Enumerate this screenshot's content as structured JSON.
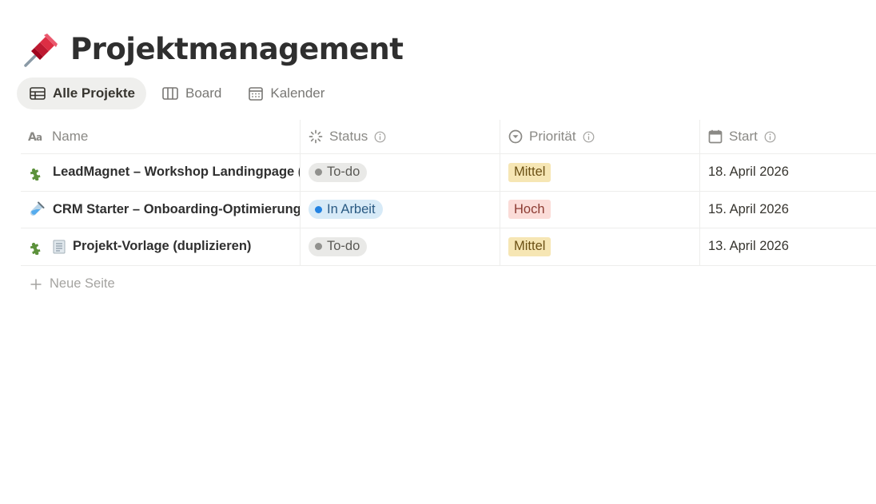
{
  "page": {
    "title": "Projektmanagement",
    "icon": "pushpin-icon"
  },
  "views": [
    {
      "label": "Alle Projekte",
      "icon": "table-icon",
      "active": true
    },
    {
      "label": "Board",
      "icon": "board-icon",
      "active": false
    },
    {
      "label": "Kalender",
      "icon": "calendar-icon",
      "active": false
    }
  ],
  "table": {
    "columns": [
      {
        "label": "Name",
        "icon": "text-property-icon"
      },
      {
        "label": "Status",
        "icon": "status-property-icon"
      },
      {
        "label": "Priorität",
        "icon": "select-property-icon"
      },
      {
        "label": "Start",
        "icon": "date-property-icon"
      }
    ],
    "rows": [
      {
        "icon": "puzzle-icon",
        "name": "LeadMagnet – Workshop Landingpage (",
        "status": "To-do",
        "priority": "Mittel",
        "start": "18. April 2026"
      },
      {
        "icon": "test-tube-icon",
        "name": "CRM Starter – Onboarding-Optimierung",
        "status": "In Arbeit",
        "priority": "Hoch",
        "start": "15. April 2026"
      },
      {
        "icon": "puzzle-icon",
        "doc_icon": "document-icon",
        "name": "Projekt-Vorlage (duplizieren)",
        "status": "To-do",
        "priority": "Mittel",
        "start": "13. April 2026"
      }
    ],
    "new_row_label": "Neue Seite"
  },
  "colors": {
    "status_todo_dot": "#91918e",
    "status_in_progress_dot": "#2383e2",
    "priority_mittel_bg": "#f6e6b4",
    "priority_hoch_bg": "#fbdcd8"
  }
}
